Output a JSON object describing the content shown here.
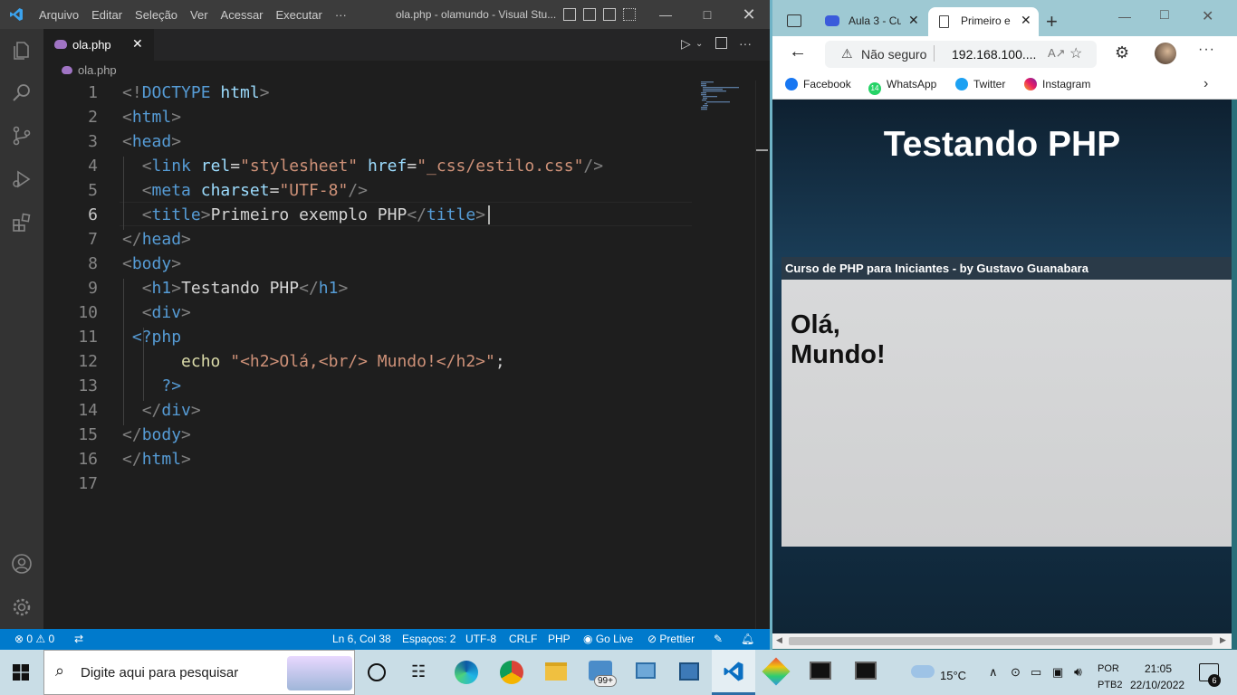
{
  "vscode": {
    "menu": [
      "Arquivo",
      "Editar",
      "Seleção",
      "Ver",
      "Acessar",
      "Executar",
      "···"
    ],
    "window_title": "ola.php - olamundo - Visual Stu...",
    "tab_label": "ola.php",
    "breadcrumb": "ola.php",
    "lines": [
      {
        "n": "1"
      },
      {
        "n": "2"
      },
      {
        "n": "3"
      },
      {
        "n": "4"
      },
      {
        "n": "5"
      },
      {
        "n": "6"
      },
      {
        "n": "7"
      },
      {
        "n": "8"
      },
      {
        "n": "9"
      },
      {
        "n": "10"
      },
      {
        "n": "11"
      },
      {
        "n": "12"
      },
      {
        "n": "13"
      },
      {
        "n": "14"
      },
      {
        "n": "15"
      },
      {
        "n": "16"
      },
      {
        "n": "17"
      }
    ],
    "code": {
      "l1_a": "<!",
      "l1_b": "DOCTYPE",
      "l1_c": " html",
      "l1_d": ">",
      "l2_tag": "html",
      "l3_tag": "head",
      "l4_tag": "link",
      "l4_attr1": "rel",
      "l4_val1": "\"stylesheet\"",
      "l4_attr2": "href",
      "l4_val2": "\"_css/estilo.css\"",
      "l5_tag": "meta",
      "l5_attr": "charset",
      "l5_val": "\"UTF-8\"",
      "l6_tag": "title",
      "l6_text": "Primeiro exemplo PHP",
      "l7_tag": "head",
      "l8_tag": "body",
      "l9_tag": "h1",
      "l9_text": "Testando PHP",
      "l10_tag": "div",
      "l11_text": "<?php",
      "l12_echo": "echo",
      "l12_str": "\"<h2>Olá,<br/> Mundo!</h2>\"",
      "l12_end": ";",
      "l13_text": "?>",
      "l14_tag": "div",
      "l15_tag": "body",
      "l16_tag": "html"
    },
    "status": {
      "errors": "0",
      "warnings": "0",
      "position": "Ln 6, Col 38",
      "spaces": "Espaços: 2",
      "encoding": "UTF-8",
      "eol": "CRLF",
      "language": "PHP",
      "golive": "Go Live",
      "prettier": "Prettier"
    },
    "colors": {
      "status_bar": "#007acc",
      "title_bar": "#3c3c3c",
      "editor": "#1e1e1e"
    }
  },
  "edge": {
    "tab1_label": "Aula 3 - Cu",
    "tab2_label": "Primeiro e",
    "not_secure": "Não seguro",
    "url": "192.168.100....",
    "bookmarks": [
      "Facebook",
      "WhatsApp",
      "Twitter",
      "Instagram"
    ],
    "whatsapp_badge": "14",
    "page": {
      "h1": "Testando PHP",
      "bar": "Curso de PHP para Iniciantes - by Gustavo Guanabara",
      "h2_line1": "Olá,",
      "h2_line2": "Mundo!"
    }
  },
  "taskbar": {
    "search_placeholder": "Digite aqui para pesquisar",
    "mail_badge": "99+",
    "temperature": "15°C",
    "lang1": "POR",
    "lang2": "PTB2",
    "time": "21:05",
    "date": "22/10/2022",
    "notifications": "6"
  }
}
